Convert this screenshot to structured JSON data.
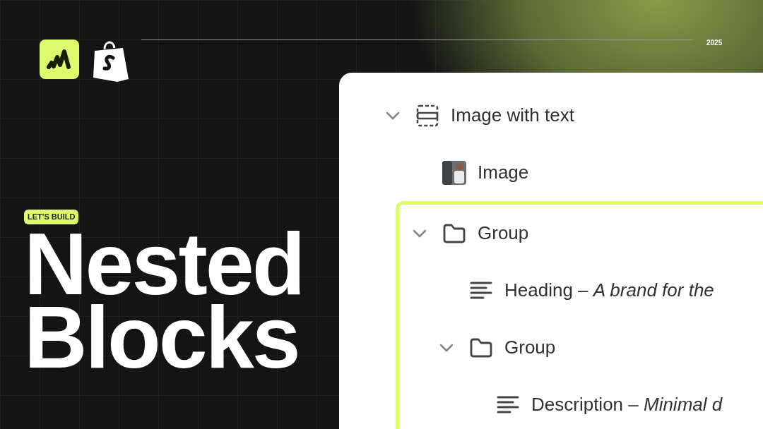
{
  "header": {
    "year": "2025"
  },
  "badge": "LET'S BUILD",
  "title_lines": [
    "Nested",
    "Blocks"
  ],
  "tree": [
    {
      "kind": "section",
      "label": "Image with text",
      "expanded": true,
      "selected": false,
      "children": [
        {
          "kind": "image",
          "label": "Image",
          "selected": false
        },
        {
          "kind": "group",
          "label": "Group",
          "expanded": true,
          "selected": true,
          "children": [
            {
              "kind": "text",
              "label": "Heading – *A brand for the*",
              "selected": false
            },
            {
              "kind": "group",
              "label": "Group",
              "expanded": true,
              "selected": false,
              "children": [
                {
                  "kind": "text",
                  "label": "Description – *Minimal d*",
                  "selected": false
                }
              ]
            }
          ]
        }
      ]
    }
  ]
}
